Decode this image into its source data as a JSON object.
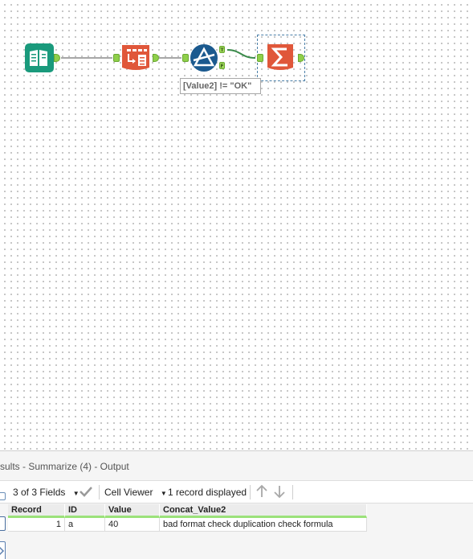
{
  "canvas": {
    "filter_annotation": "[Value2] != \"OK\"",
    "filter_true_label": "T",
    "filter_false_label": "F"
  },
  "results": {
    "title": "sults - Summarize (4) - Output",
    "toolbar": {
      "fields": "3 of 3 Fields",
      "viewer": "Cell Viewer",
      "records": "1 record displayed"
    },
    "grid": {
      "columns": [
        "Record",
        "ID",
        "Value",
        "Concat_Value2"
      ],
      "rows": [
        [
          "1",
          "a",
          "40",
          "bad format check duplication check formula"
        ]
      ]
    }
  },
  "colors": {
    "input_tool": "#1a9a7c",
    "transform_tool": "#e0573a",
    "filter_tool": "#1b5a8f",
    "anchor": "#8fcf4a",
    "header_accent": "#9be27a"
  }
}
